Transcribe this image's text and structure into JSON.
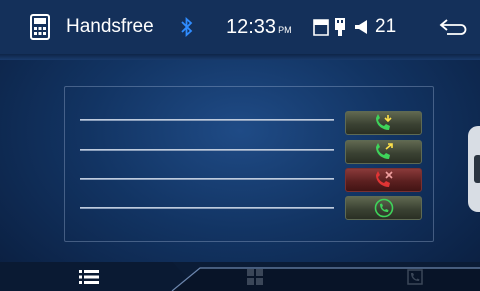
{
  "status_bar": {
    "title": "Handsfree",
    "time": "12:33",
    "ampm": "PM",
    "volume": "21",
    "icons": [
      "phone-icon",
      "bluetooth-icon",
      "sd-card-icon",
      "usb-icon",
      "volume-icon",
      "back-icon"
    ]
  },
  "call_list": {
    "rows": [
      {
        "action": "accept-call-icon"
      },
      {
        "action": "transfer-call-icon"
      },
      {
        "action": "end-call-icon"
      },
      {
        "action": "answer-call-icon"
      }
    ]
  },
  "bottom_nav": {
    "tabs": [
      "list-icon",
      "keypad-icon",
      "contacts-icon"
    ],
    "active": "list-icon"
  },
  "colors": {
    "accent_green": "#3ed35a",
    "accent_red": "#e03434",
    "bluetooth": "#2f8cff"
  }
}
